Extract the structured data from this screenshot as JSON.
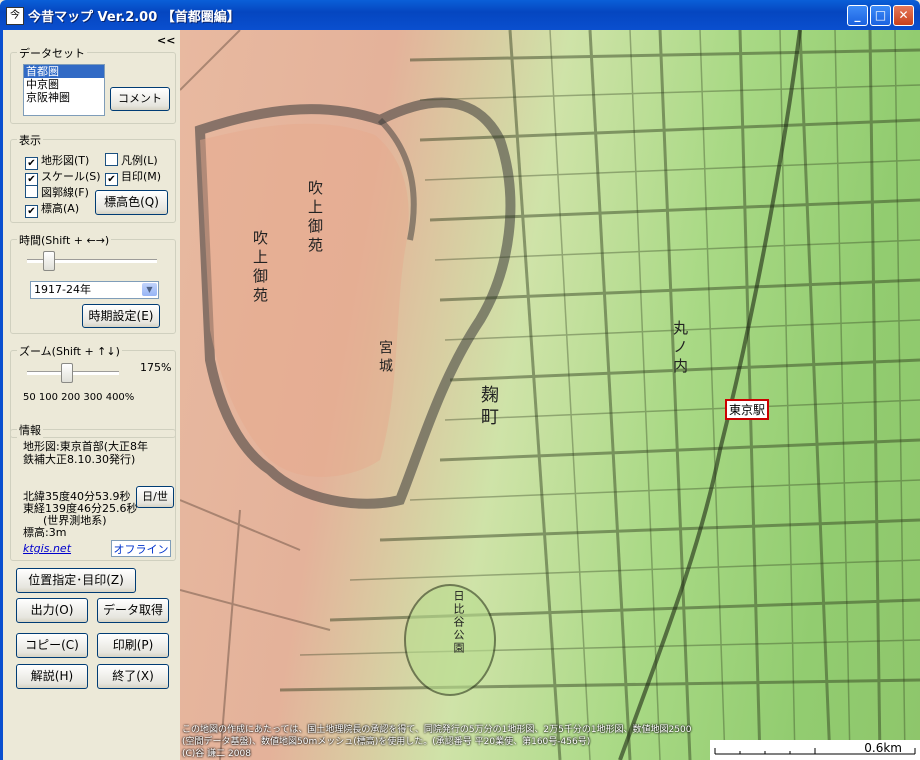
{
  "window": {
    "title": "今昔マップ Ver.2.00 【首都圏編】",
    "app_icon": "今"
  },
  "panel": {
    "collapse": "<<",
    "dataset": {
      "title": "データセット",
      "items": [
        "首都圏",
        "中京圏",
        "京阪神圏"
      ],
      "selected_index": 0,
      "comment_button": "コメント"
    },
    "display": {
      "title": "表示",
      "checks": [
        {
          "label": "地形図(T)",
          "checked": true
        },
        {
          "label": "凡例(L)",
          "checked": false
        },
        {
          "label": "スケール(S)",
          "checked": true
        },
        {
          "label": "目印(M)",
          "checked": true
        },
        {
          "label": "図郭線(F)",
          "checked": false
        },
        {
          "label": "標高(A)",
          "checked": true
        }
      ],
      "elevation_color_button": "標高色(Q)"
    },
    "period": {
      "title": "時間(Shift + ←→)",
      "slider_value": 0.2,
      "selected": "1917-24年",
      "settings_button": "時期設定(E)"
    },
    "zoom": {
      "title": "ズーム(Shift + ↑↓)",
      "value_label": "175%",
      "scale_labels": "50 100 200 300 400%",
      "slider_value": 0.4
    },
    "info": {
      "title": "情報",
      "map_line1": "地形図:東京首部(大正8年",
      "map_line2": "鉄補大正8.10.30発行)",
      "lat": "北緯35度40分53.9秒",
      "lon": "東経139度46分25.6秒",
      "datum": "(世界測地系)",
      "elevation": "標高:3m",
      "datum_toggle": "日/世",
      "link": "ktgis.net",
      "status": "オフライン"
    },
    "buttons": {
      "locate": "位置指定･目印(Z)",
      "output": "出力(O)",
      "get_data": "データ取得",
      "copy": "コピー(C)",
      "print": "印刷(P)",
      "help": "解説(H)",
      "exit": "終了(X)"
    }
  },
  "map": {
    "station_label": "東京駅",
    "labels": {
      "gyoen1": "吹上御苑",
      "gyoen2": "吹上御苑",
      "kyujo": "宮城",
      "kojimachi": "麹町",
      "marunouchi": "丸ノ内",
      "hibiya": "日比谷公園"
    },
    "credit_line1": "この地図の作成にあたっては、国土地理院長の承認を得て、同院発行の5万分の1地形図、2万5千分の1地形図、数値地図2500",
    "credit_line2": "(空間データ基盤)、数値地図50mメッシュ(標高)を使用した。(承認番号 平20業使、第160号-456号)",
    "credit_line3": "(C)谷 謙二 2008",
    "scale_label": "0.6km"
  },
  "colors": {
    "title_bar": "#0a4fcf",
    "selection": "#316ac5",
    "station_border": "#cc0000",
    "link": "#0000cc",
    "status": "#0033cc"
  }
}
